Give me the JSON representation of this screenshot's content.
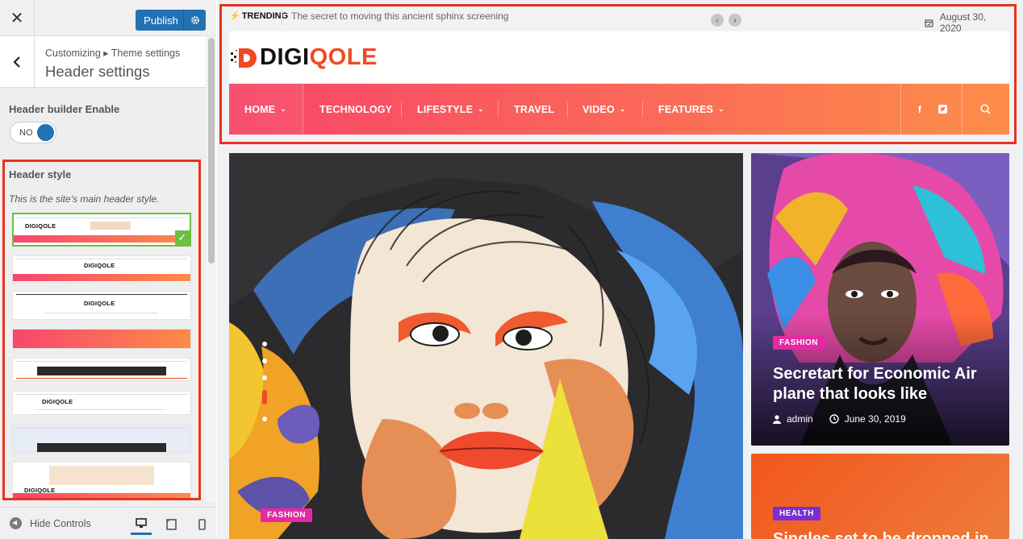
{
  "sidebar": {
    "close_label": "✕",
    "publish_label": "Publish",
    "breadcrumb_path": "Customizing ▸ Theme settings",
    "section_title": "Header settings",
    "header_builder_label": "Header builder Enable",
    "toggle_state": "NO",
    "header_style_title": "Header style",
    "header_style_desc": "This is the site's main header style.",
    "thumb_logo": "DIGIQOLE",
    "hide_controls_label": "Hide Controls"
  },
  "preview": {
    "trending_label": "TRENDING",
    "trending_text": "The secret to moving this ancient sphinx screening",
    "date": "August 30, 2020",
    "logo_text_dark": "DIGI",
    "logo_text_orange": "QOLE",
    "nav": [
      {
        "label": "HOME",
        "dropdown": true
      },
      {
        "label": "TECHNOLOGY",
        "dropdown": false
      },
      {
        "label": "LIFESTYLE",
        "dropdown": true
      },
      {
        "label": "TRAVEL",
        "dropdown": false
      },
      {
        "label": "VIDEO",
        "dropdown": true
      },
      {
        "label": "FEATURES",
        "dropdown": true
      }
    ],
    "social_facebook": "f",
    "hero": {
      "category": "FASHION"
    },
    "card1": {
      "category": "FASHION",
      "title": "Secretart for Economic Air plane that looks like",
      "author": "admin",
      "date": "June 30, 2019"
    },
    "card2": {
      "category": "HEALTH",
      "title": "Singles set to be dropped in"
    }
  },
  "colors": {
    "accent_blue": "#2271b1",
    "highlight_red": "#e8321f",
    "nav_gradient_start": "#f84568",
    "nav_gradient_end": "#fd8d49",
    "selected_green": "#6cbf3f",
    "fashion_tag": "#e528a4",
    "health_tag": "#7a2ed1"
  },
  "icons": [
    "close-icon",
    "gear-icon",
    "chevron-left-icon",
    "check-icon",
    "desktop-icon",
    "tablet-icon",
    "mobile-icon",
    "bolt-icon",
    "calendar-icon",
    "facebook-icon",
    "twitter-icon",
    "search-icon",
    "user-icon",
    "clock-icon"
  ]
}
